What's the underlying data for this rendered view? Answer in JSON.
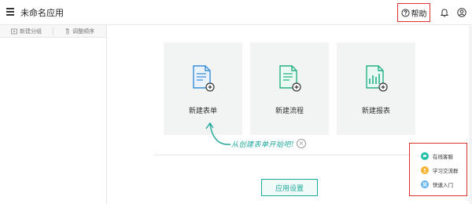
{
  "header": {
    "title": "未命名应用",
    "help_label": "帮助",
    "icons": {
      "menu": "menu-icon",
      "help": "question-circle-icon",
      "bell": "bell-icon",
      "user": "user-circle-icon"
    }
  },
  "sidebar": {
    "new_group_label": "新建分组",
    "adjust_order_label": "调整顺序"
  },
  "main": {
    "cards": [
      {
        "label": "新建表单",
        "icon": "form-document-icon"
      },
      {
        "label": "新建流程",
        "icon": "flow-document-icon"
      },
      {
        "label": "新建报表",
        "icon": "report-chart-icon"
      }
    ],
    "hint_text": "从创建表单开始吧!",
    "hint_close": "×",
    "settings_button": "应用设置"
  },
  "float_panel": {
    "items": [
      {
        "label": "在线客服",
        "color": "#26c0a8",
        "icon": "chat-icon"
      },
      {
        "label": "学习交流群",
        "color": "#f5b331",
        "icon": "group-icon"
      },
      {
        "label": "快速入门",
        "color": "#5ab0f0",
        "icon": "guide-icon"
      }
    ]
  },
  "colors": {
    "accent": "#20a89c",
    "highlight": "#e03030",
    "card_bg": "#f2f4f3"
  }
}
